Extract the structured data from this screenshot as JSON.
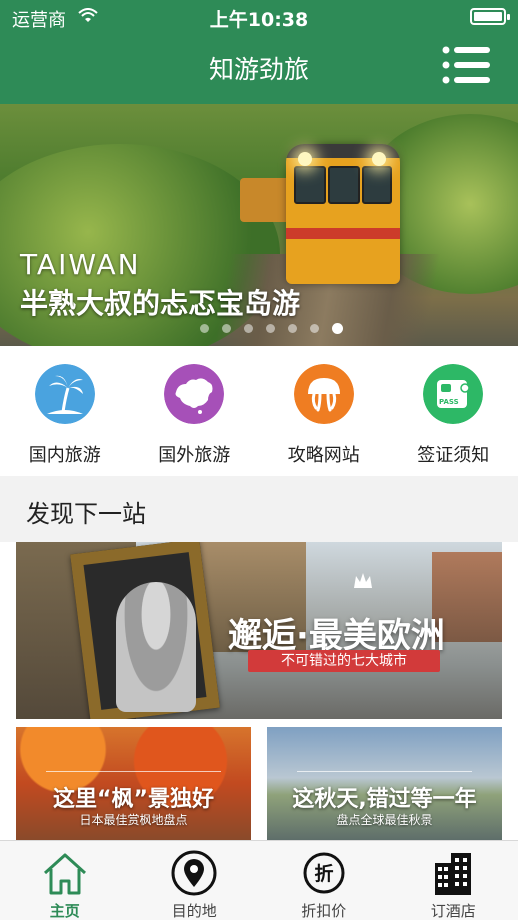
{
  "status_bar": {
    "carrier": "运营商",
    "time": "上午10:38",
    "wifi_icon": "wifi-icon",
    "battery_icon": "battery-icon"
  },
  "nav": {
    "title": "知游劲旅",
    "menu_icon": "menu-list-icon"
  },
  "banner": {
    "subtitle": "TAIWAN",
    "caption": "半熟大叔的忐忑宝岛游",
    "dot_count": 7,
    "active_dot": 6
  },
  "categories": [
    {
      "label": "国内旅游",
      "icon": "palm-tree-icon",
      "color": "#4aa3df"
    },
    {
      "label": "国外旅游",
      "icon": "china-map-icon",
      "color": "#a650b8"
    },
    {
      "label": "攻略网站",
      "icon": "jellyfish-icon",
      "color": "#ef7d22"
    },
    {
      "label": "签证须知",
      "icon": "passport-icon",
      "color": "#2db866"
    }
  ],
  "discover": {
    "title": "发现下一站",
    "feature": {
      "title": "邂逅·最美欧洲",
      "ribbon": "不可错过的七大城市"
    },
    "cards": [
      {
        "title": "这里“枫”景独好",
        "subtitle": "日本最佳赏枫地盘点"
      },
      {
        "title": "这秋天,错过等一年",
        "subtitle": "盘点全球最佳秋景"
      }
    ]
  },
  "tabbar": {
    "active_color": "#2e8b57",
    "tabs": [
      {
        "label": "主页",
        "icon": "home-icon",
        "active": true
      },
      {
        "label": "目的地",
        "icon": "location-pin-icon",
        "active": false
      },
      {
        "label": "折扣价",
        "icon": "discount-icon",
        "active": false
      },
      {
        "label": "订酒店",
        "icon": "hotel-icon",
        "active": false
      }
    ]
  },
  "theme": {
    "primary": "#2e8b57"
  }
}
